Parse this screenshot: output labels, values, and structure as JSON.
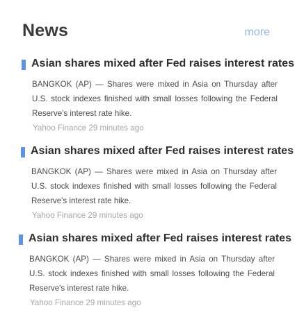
{
  "widget": {
    "title": "News",
    "more_label": "more",
    "accent_color": "#5b93e8",
    "link_color": "#8fb8e6"
  },
  "articles": [
    {
      "headline": "Asian shares mixed after Fed raises interest rates",
      "summary": "BANGKOK (AP) — Shares were mixed in Asia on Thursday after U.S. stock indexes finished with small losses following the Federal Reserve's interest rate hike.",
      "source": "Yahoo Finance",
      "time": "29 minutes ago"
    },
    {
      "headline": "Asian shares mixed after Fed raises interest rates",
      "summary": "BANGKOK (AP) — Shares were mixed in Asia on Thursday after U.S. stock indexes finished with small losses following the Federal Reserve's interest rate hike.",
      "source": "Yahoo Finance",
      "time": "29 minutes ago"
    },
    {
      "headline": "Asian shares mixed after Fed raises interest rates",
      "summary": "BANGKOK (AP) — Shares were mixed in Asia on Thursday after U.S. stock indexes finished with small losses following the Federal Reserve's interest rate hike.",
      "source": "Yahoo Finance",
      "time": "29 minutes ago"
    }
  ]
}
